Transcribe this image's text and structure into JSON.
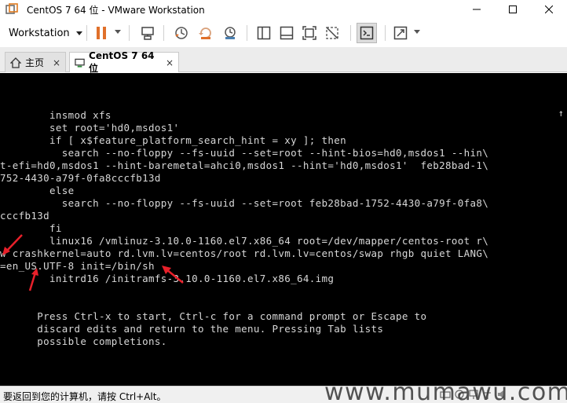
{
  "window": {
    "title": "CentOS 7 64 位 - VMware Workstation"
  },
  "toolbar": {
    "workstation_label": "Workstation",
    "icons": [
      "pause-icon",
      "send-keys-icon",
      "snapshot-icon",
      "revert-snapshot-icon",
      "snapshot-manager-icon",
      "library-icon",
      "thumbnail-icon",
      "fullscreen-icon",
      "unity-icon",
      "console-icon",
      "stretch-icon"
    ]
  },
  "tabs": [
    {
      "label": "主页",
      "icon": "home-icon"
    },
    {
      "label": "CentOS 7 64 位",
      "icon": "vm-icon",
      "active": true
    }
  ],
  "console": {
    "lines": [
      "        insmod xfs",
      "        set root='hd0,msdos1'",
      "        if [ x$feature_platform_search_hint = xy ]; then",
      "          search --no-floppy --fs-uuid --set=root --hint-bios=hd0,msdos1 --hin\\",
      "t-efi=hd0,msdos1 --hint-baremetal=ahci0,msdos1 --hint='hd0,msdos1'  feb28bad-1\\",
      "752-4430-a79f-0fa8cccfb13d",
      "        else",
      "          search --no-floppy --fs-uuid --set=root feb28bad-1752-4430-a79f-0fa8\\",
      "cccfb13d",
      "        fi",
      "        linux16 /vmlinuz-3.10.0-1160.el7.x86_64 root=/dev/mapper/centos-root r\\",
      "w crashkernel=auto rd.lvm.lv=centos/root rd.lvm.lv=centos/swap rhgb quiet LANG\\",
      "=en_US.UTF-8 init=/bin/sh",
      "        initrd16 /initramfs-3.10.0-1160.el7.x86_64.img",
      "",
      "",
      "      Press Ctrl-x to start, Ctrl-c for a command prompt or Escape to",
      "      discard edits and return to the menu. Pressing Tab lists",
      "      possible completions."
    ],
    "scroll_indicator": "↑",
    "annotation_color": "#e8202a"
  },
  "statusbar": {
    "text": "要返回到您的计算机，请按 Ctrl+Alt。"
  },
  "watermark": "www.mumawu.com",
  "colors": {
    "accent": "#e0702a",
    "console_bg": "#000000",
    "console_fg": "#d8d8d8"
  }
}
